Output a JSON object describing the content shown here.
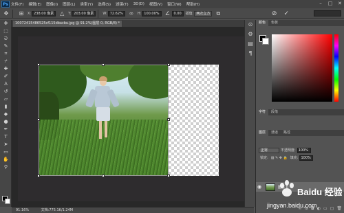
{
  "app": {
    "logo": "Ps",
    "menu": [
      "文件(F)",
      "编辑(E)",
      "图像(I)",
      "图层(L)",
      "类型(Y)",
      "选择(S)",
      "滤镜(T)",
      "3D(D)",
      "视图(V)",
      "窗口(W)",
      "帮助(H)"
    ],
    "window_controls": [
      "–",
      "□",
      "✕"
    ]
  },
  "options": {
    "x_label": "X:",
    "x_value": "238.00 像素",
    "y_label": "Y:",
    "y_value": "203.00 像素",
    "w_label": "W:",
    "w_value": "72.62%",
    "h_label": "H:",
    "h_value": "100.00%",
    "angle_value": "0.00",
    "interp_label": "插值:",
    "interp_value": "两次立方",
    "cancel_glyph": "⊘",
    "commit_glyph": "✓"
  },
  "document": {
    "tab_title": "10072415486525cf115dbacbu.jpg @ 91.2%(图层 0, RGB/8) *"
  },
  "status": {
    "zoom": "91.16%",
    "doc_info": "文档:775.1K/1.24M"
  },
  "panels": {
    "color_tabs": [
      "颜色",
      "色板"
    ],
    "adjust_tabs": [
      "字符",
      "段落"
    ],
    "layers_tabs": [
      "图层",
      "通道",
      "路径"
    ],
    "blend_mode": "正常",
    "opacity_label": "不透明度:",
    "opacity_value": "100%",
    "lock_label": "锁定:",
    "fill_label": "填充:",
    "fill_value": "100%",
    "layer_name": "图层 0"
  },
  "watermark": {
    "brand": "Baidu 经验",
    "url": "jingyan.baidu.com"
  }
}
